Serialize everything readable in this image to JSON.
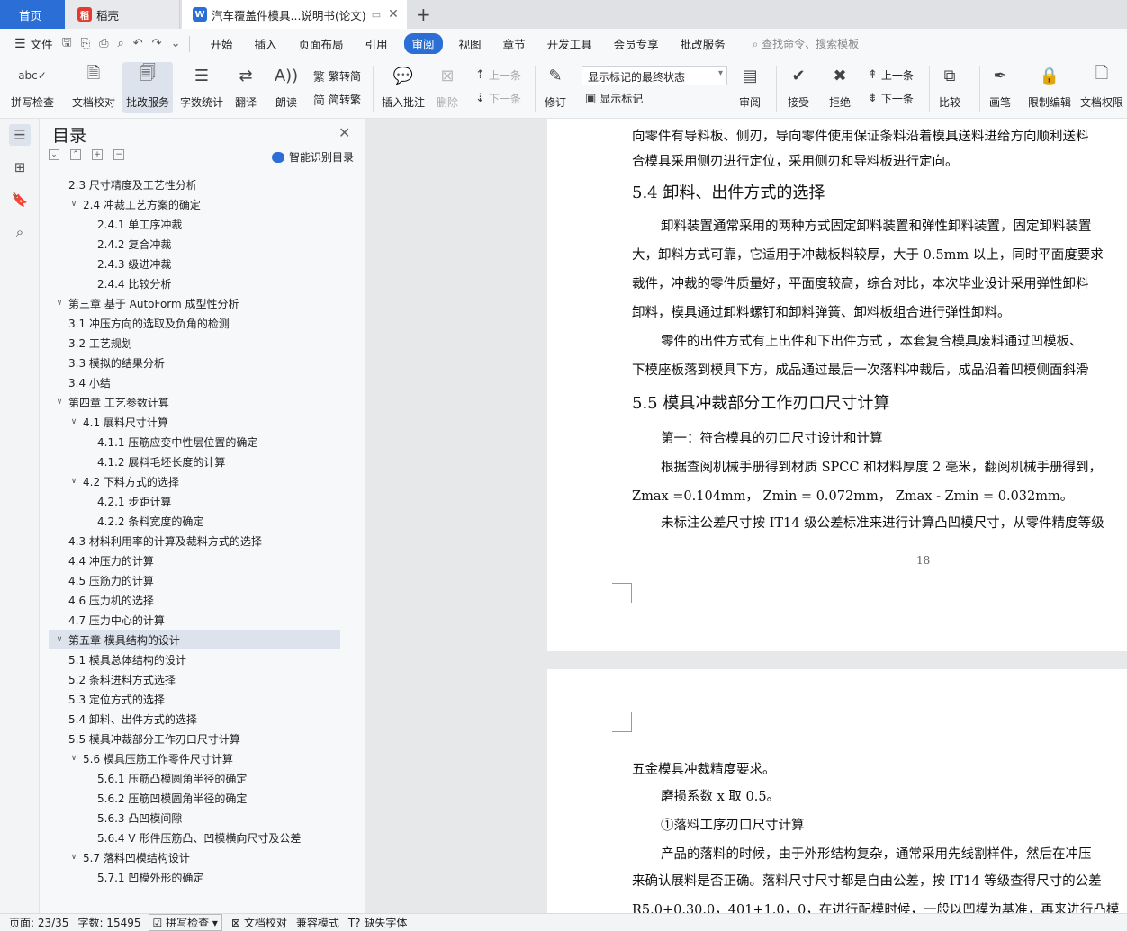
{
  "tabs": {
    "home": "首页",
    "daoke": "稻壳",
    "doc": "汽车覆盖件模具...说明书(论文)"
  },
  "menubar": {
    "file": "文件",
    "items": [
      "开始",
      "插入",
      "页面布局",
      "引用",
      "审阅",
      "视图",
      "章节",
      "开发工具",
      "会员专享",
      "批改服务"
    ],
    "active": "审阅",
    "search": "查找命令、搜索模板"
  },
  "ribbon": {
    "spellcheck": "拼写检查",
    "doc_proof": "文档校对",
    "revise_service": "批改服务",
    "word_count": "字数统计",
    "translate": "翻译",
    "read_aloud": "朗读",
    "trad": "繁转简",
    "simp": "简转繁",
    "insert_comment": "插入批注",
    "delete": "删除",
    "prev": "上一条",
    "next": "下一条",
    "track": "修订",
    "markup_state": "显示标记的最终状态",
    "show_markup": "显示标记",
    "review": "审阅",
    "accept": "接受",
    "reject": "拒绝",
    "prev2": "上一条",
    "next2": "下一条",
    "compare": "比较",
    "pen": "画笔",
    "restrict": "限制编辑",
    "doc_perm": "文档权限"
  },
  "toc": {
    "title": "目录",
    "smart": "智能识别目录",
    "items": [
      {
        "text": "2.3 尺寸精度及工艺性分析",
        "level": 2,
        "caret": ""
      },
      {
        "text": "2.4 冲裁工艺方案的确定",
        "level": 2,
        "caret": "v"
      },
      {
        "text": "2.4.1 单工序冲裁",
        "level": 3,
        "caret": ""
      },
      {
        "text": "2.4.2 复合冲裁",
        "level": 3,
        "caret": ""
      },
      {
        "text": "2.4.3 级进冲裁",
        "level": 3,
        "caret": ""
      },
      {
        "text": "2.4.4 比较分析",
        "level": 3,
        "caret": ""
      },
      {
        "text": "第三章  基于 AutoForm 成型性分析",
        "level": 1,
        "caret": "v"
      },
      {
        "text": "3.1  冲压方向的选取及负角的检测",
        "level": 2,
        "caret": ""
      },
      {
        "text": "3.2  工艺规划",
        "level": 2,
        "caret": ""
      },
      {
        "text": "3.3  模拟的结果分析",
        "level": 2,
        "caret": ""
      },
      {
        "text": "3.4  小结",
        "level": 2,
        "caret": ""
      },
      {
        "text": "第四章  工艺参数计算",
        "level": 1,
        "caret": "v"
      },
      {
        "text": "4.1 展料尺寸计算",
        "level": 2,
        "caret": "v"
      },
      {
        "text": "4.1.1 压筋应变中性层位置的确定",
        "level": 3,
        "caret": ""
      },
      {
        "text": "4.1.2 展料毛坯长度的计算",
        "level": 3,
        "caret": ""
      },
      {
        "text": "4.2 下料方式的选择",
        "level": 2,
        "caret": "v"
      },
      {
        "text": "4.2.1 步距计算",
        "level": 3,
        "caret": ""
      },
      {
        "text": "4.2.2 条料宽度的确定",
        "level": 3,
        "caret": ""
      },
      {
        "text": "4.3 材料利用率的计算及裁料方式的选择",
        "level": 2,
        "caret": ""
      },
      {
        "text": "4.4 冲压力的计算",
        "level": 2,
        "caret": ""
      },
      {
        "text": "4.5 压筋力的计算",
        "level": 2,
        "caret": ""
      },
      {
        "text": "4.6 压力机的选择",
        "level": 2,
        "caret": ""
      },
      {
        "text": "4.7 压力中心的计算",
        "level": 2,
        "caret": ""
      },
      {
        "text": "第五章  模具结构的设计",
        "level": 1,
        "caret": "v"
      },
      {
        "text": "5.1 模具总体结构的设计",
        "level": 2,
        "caret": ""
      },
      {
        "text": "5.2 条料进料方式选择",
        "level": 2,
        "caret": ""
      },
      {
        "text": "5.3 定位方式的选择",
        "level": 2,
        "caret": ""
      },
      {
        "text": "5.4 卸料、出件方式的选择",
        "level": 2,
        "caret": ""
      },
      {
        "text": "5.5 模具冲裁部分工作刃口尺寸计算",
        "level": 2,
        "caret": ""
      },
      {
        "text": "5.6 模具压筋工作零件尺寸计算",
        "level": 2,
        "caret": "v"
      },
      {
        "text": "5.6.1 压筋凸模圆角半径的确定",
        "level": 3,
        "caret": ""
      },
      {
        "text": "5.6.2 压筋凹模圆角半径的确定",
        "level": 3,
        "caret": ""
      },
      {
        "text": "5.6.3 凸凹模间隙",
        "level": 3,
        "caret": ""
      },
      {
        "text": "5.6.4 V 形件压筋凸、凹模横向尺寸及公差",
        "level": 3,
        "caret": ""
      },
      {
        "text": "5.7 落料凹模结构设计",
        "level": 2,
        "caret": "v"
      },
      {
        "text": "5.7.1 凹模外形的确定",
        "level": 3,
        "caret": ""
      }
    ],
    "selected_index": 23
  },
  "document": {
    "page1_lines": [
      "向零件有导料板、侧刃，导向零件使用保证条料沿着模具送料进给方向顺利送料",
      "合模具采用侧刃进行定位，采用侧刃和导料板进行定向。"
    ],
    "heading_54": "5.4 卸料、出件方式的选择",
    "para_54": [
      "卸料装置通常采用的两种方式固定卸料装置和弹性卸料装置，固定卸料装置",
      "大，卸料方式可靠，它适用于冲裁板料较厚，大于 0.5mm 以上，同时平面度要求",
      "裁件，冲裁的零件质量好，平面度较高，综合对比，本次毕业设计采用弹性卸料",
      "卸料，模具通过卸料螺钉和卸料弹簧、卸料板组合进行弹性卸料。",
      "零件的出件方式有上出件和下出件方式 ，本套复合模具废料通过凹模板、",
      "下模座板落到模具下方，成品通过最后一次落料冲裁后，成品沿着凹模侧面斜滑"
    ],
    "heading_55": "5.5 模具冲裁部分工作刃口尺寸计算",
    "para_55": [
      "第一：符合模具的刃口尺寸设计和计算",
      "根据查阅机械手册得到材质 SPCC 和材料厚度 2 毫米，翻阅机械手册得到，",
      "Zmax =0.104mm， Zmin = 0.072mm， Zmax - Zmin = 0.032mm。",
      "未标注公差尺寸按 IT14 级公差标准来进行计算凸凹模尺寸，从零件精度等级"
    ],
    "page_number": "18",
    "page2_lines": [
      "五金模具冲裁精度要求。",
      "磨损系数 x 取 0.5。",
      "①落料工序刃口尺寸计算",
      "产品的落料的时候，由于外形结构复杂，通常采用先线割样件，然后在冲压",
      "来确认展料是否正确。落料尺寸尺寸都是自由公差，按 IT14 等级查得尺寸的公差",
      "R5.0+0.30.0，401+1.0，0，在进行配模时候，一般以凹模为基准，再来进行凸模"
    ]
  },
  "status": {
    "page": "页面: 23/35",
    "words": "字数: 15495",
    "spell": "拼写检查",
    "proof": "文档校对",
    "compat": "兼容模式",
    "missing_font": "缺失字体"
  }
}
